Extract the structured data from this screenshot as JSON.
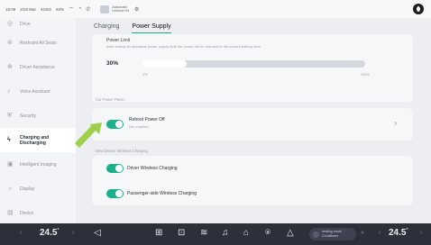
{
  "status": {
    "time": "16:09",
    "date": "2/28 Mar",
    "network": "4G5G",
    "battery": "93%",
    "media_title": "Automatic",
    "media_subtitle": "Unlined Hit"
  },
  "sidebar": {
    "items": [
      {
        "label": "Drive",
        "icon": "steering-icon"
      },
      {
        "label": "Restraint All Seats",
        "icon": "seat-icon"
      },
      {
        "label": "Driver Assistance",
        "icon": "assist-icon"
      },
      {
        "label": "Voice Assistant",
        "icon": "voice-icon"
      },
      {
        "label": "Security",
        "icon": "shield-icon"
      },
      {
        "label": "Charging and Discharging",
        "icon": "charging-icon"
      },
      {
        "label": "Intelligent Imaging",
        "icon": "camera-icon"
      },
      {
        "label": "Display",
        "icon": "display-icon"
      },
      {
        "label": "Device",
        "icon": "device-icon"
      }
    ]
  },
  "tabs": [
    {
      "label": "Charging"
    },
    {
      "label": "Power Supply"
    }
  ],
  "power": {
    "label": "Power Limit",
    "description": "After setting an allowable power supply limit the power will be reduced to the current battery level",
    "value_text": "30%",
    "fill_fraction": 0.2,
    "min_label": "0%",
    "max_label": "100%"
  },
  "section1_label": "Car Power Panel",
  "auto_power_off": {
    "title": "Reboot Power Off",
    "subtitle": "Not enabled"
  },
  "section2_label": "New Device Wireless Charging",
  "wireless": {
    "item1": "Driver Wireless Charging",
    "item2": "Passenger-side Wireless Charging"
  },
  "bottom": {
    "temp_left": "24.5",
    "temp_right": "24.5",
    "unit": "°",
    "btn_line1": "heating mode",
    "btn_line2": "Conditioner",
    "more": "»"
  },
  "colors": {
    "accent": "#19b08a",
    "highlight_arrow": "#9ed04a"
  }
}
